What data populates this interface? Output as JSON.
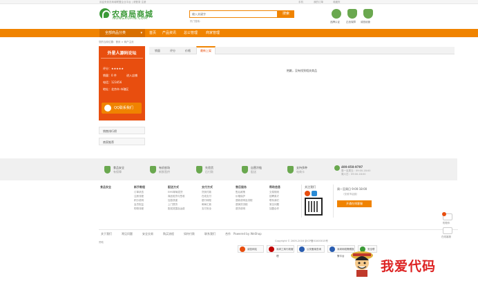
{
  "topbar": {
    "welcome": "欢迎来到农商城联盟企业平台 | 请登录 注册",
    "right_links": [
      "手机",
      "我的订单",
      "收藏夹"
    ]
  },
  "logo": {
    "name": "农商局商城",
    "domain": "NONGXUPIN.COM"
  },
  "search": {
    "placeholder": "输入关键字",
    "button": "搜索",
    "hot_label": "热门搜索："
  },
  "badges": [
    {
      "label": "品牌认证",
      "color": "#6aa84f"
    },
    {
      "label": "正品保障",
      "color": "#6aa84f"
    },
    {
      "label": "诚信经营",
      "color": "#6aa84f"
    }
  ],
  "nav": {
    "category": "全部商品分类",
    "items": [
      "首页",
      "产品资讯",
      "总公管理",
      "商家管理"
    ]
  },
  "breadcrumb": "您的当前位置：首页 > 商户主页",
  "store": {
    "title": "外星人源码论坛",
    "rating_label": "评分：★★★★★",
    "sales_label": "销量：0 件",
    "visit_label": "进入店铺",
    "phone_label": "电话：123456",
    "address_label": "地址：北京市 市辖区",
    "qq_label": "QQ联系我们"
  },
  "side_boxes": [
    "销售排行榜",
    "商家推荐"
  ],
  "tabs": {
    "items": [
      "销量",
      "评分",
      "价格"
    ],
    "active": "最新上架"
  },
  "empty_msg": "抱歉，没有找到相关商品",
  "guarantees": [
    {
      "title": "食品安全",
      "sub": "有保障"
    },
    {
      "title": "有机农场",
      "sub": "新鲜直供"
    },
    {
      "title": "先验货",
      "sub": "后付款"
    },
    {
      "title": "自营冷链",
      "sub": "配送"
    },
    {
      "title": "支持多种",
      "sub": "电商卡"
    }
  ],
  "hotline": {
    "number": "400-858-9797",
    "line1": "周一至周五：09:00-18:00",
    "line2": "周六日：09:00-18:00"
  },
  "footer_cols": [
    {
      "head": "食品安全",
      "links": []
    },
    {
      "head": "新手教程",
      "links": [
        "订单状态",
        "注册流程",
        "积分说明",
        "会员权益",
        "购物流程"
      ]
    },
    {
      "head": "配送方式",
      "links": [
        "EMS邮局发货",
        "商品验货与签收",
        "加急快递",
        "上门提货",
        "配送范围及运费"
      ]
    },
    {
      "head": "支付方式",
      "links": [
        "货到付款",
        "在线支付",
        "银行转账",
        "邮局汇款",
        "支付安全"
      ]
    },
    {
      "head": "售后服务",
      "links": [
        "售后政策",
        "价格保护",
        "退款说明及流程",
        "退换货流程",
        "退货说明"
      ]
    },
    {
      "head": "帮助信息",
      "links": [
        "交易规则",
        "招聘英才",
        "联系我们",
        "常见问题",
        "加盟合作"
      ]
    }
  ],
  "follow_label": "关注我们",
  "service": {
    "hours": "周一至周日 9:00-18:00",
    "note": "（仅收市话费）",
    "button": "开通在线客服"
  },
  "bottom_links": [
    "关于我们",
    "常见问题",
    "安全交易",
    "购买流程",
    "如何付款",
    "联系我们",
    "合作"
  ],
  "powered": "Powered by WeShop",
  "copyright": "Copyright © 2005-2016 京ICP备01000015号",
  "footnote": "赞助",
  "certs": [
    {
      "label": "诚信网站",
      "color": "#e84e0f"
    },
    {
      "label": "深圳工商行政管理",
      "color": "#c00000"
    },
    {
      "label": "公安备案查询",
      "color": "#2a5db0"
    },
    {
      "label": "深圳网络警察报警平台",
      "color": "#2a5db0"
    },
    {
      "label": "安全联盟",
      "color": "#3b9a38"
    }
  ],
  "right_tool": {
    "cart": "购物车",
    "feedback": "在线客服"
  },
  "watermark": "我爱代码"
}
